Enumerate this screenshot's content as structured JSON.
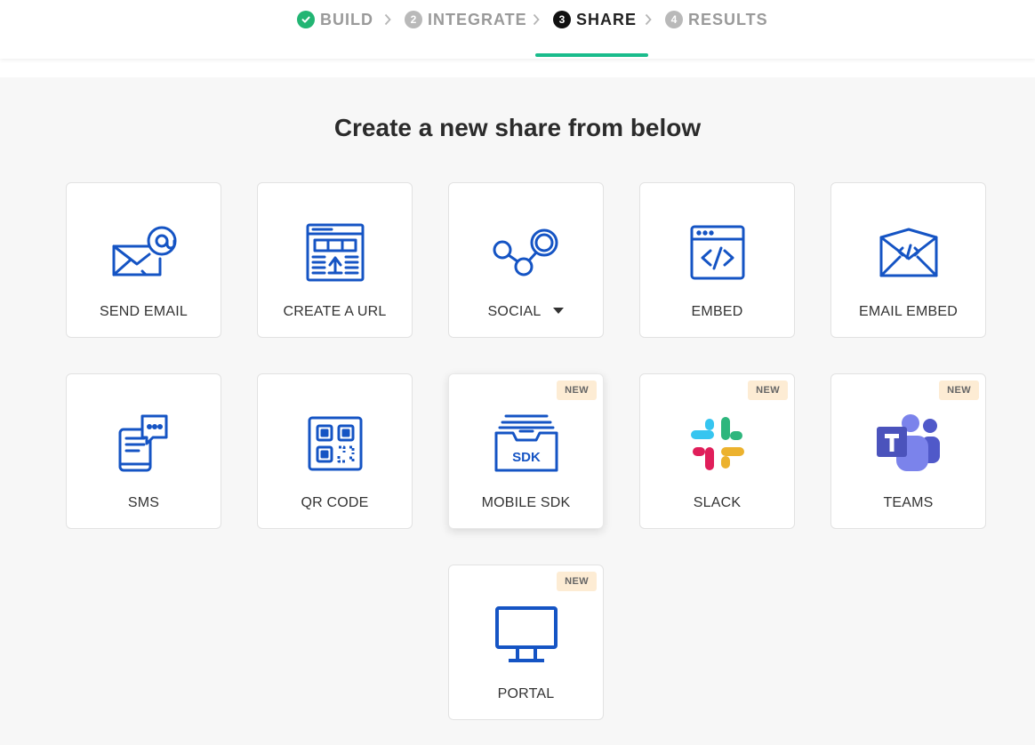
{
  "stepper": {
    "steps": [
      {
        "num": "✓",
        "label": "BUILD",
        "state": "done"
      },
      {
        "num": "2",
        "label": "INTEGRATE",
        "state": "pending"
      },
      {
        "num": "3",
        "label": "SHARE",
        "state": "active"
      },
      {
        "num": "4",
        "label": "RESULTS",
        "state": "pending"
      }
    ]
  },
  "colors": {
    "accent": "#1abc8c",
    "icon_blue": "#1554c4",
    "badge_bg": "#fdecd4"
  },
  "main": {
    "heading": "Create a new share from below",
    "options": [
      {
        "label": "SEND EMAIL",
        "icon": "envelope-at-icon"
      },
      {
        "label": "CREATE A URL",
        "icon": "webpage-upload-icon"
      },
      {
        "label": "SOCIAL",
        "icon": "share-nodes-icon",
        "dropdown": true
      },
      {
        "label": "EMBED",
        "icon": "code-window-icon"
      },
      {
        "label": "EMAIL EMBED",
        "icon": "envelope-code-icon"
      },
      {
        "label": "SMS",
        "icon": "phone-chat-icon"
      },
      {
        "label": "QR CODE",
        "icon": "qr-code-icon"
      },
      {
        "label": "MOBILE SDK",
        "icon": "sdk-tray-icon",
        "badge": "NEW"
      },
      {
        "label": "SLACK",
        "icon": "slack-icon",
        "badge": "NEW"
      },
      {
        "label": "TEAMS",
        "icon": "teams-icon",
        "badge": "NEW"
      },
      {
        "label": "PORTAL",
        "icon": "monitor-icon",
        "badge": "NEW"
      }
    ]
  }
}
